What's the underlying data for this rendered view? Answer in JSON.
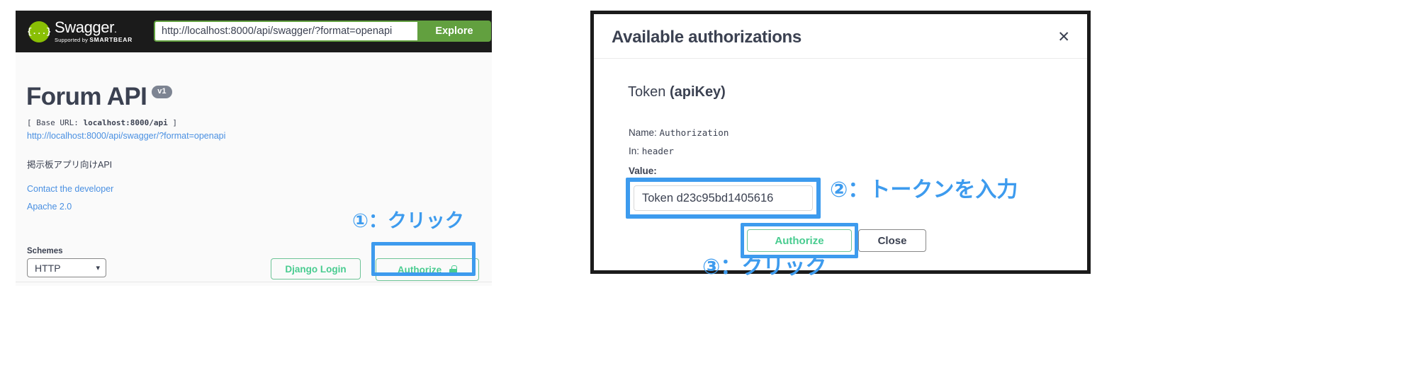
{
  "swagger": {
    "topbar": {
      "logo_name": "Swagger",
      "logo_braces": "{...}",
      "logo_supported_prefix": "Supported by ",
      "logo_supported_brand": "SMARTBEAR",
      "url_value": "http://localhost:8000/api/swagger/?format=openapi",
      "explore_label": "Explore"
    },
    "info": {
      "title": "Forum API",
      "version": "v1",
      "base_url_prefix": "[ Base URL: ",
      "base_url": "localhost:8000/api",
      "base_url_suffix": " ]",
      "spec_link": "http://localhost:8000/api/swagger/?format=openapi",
      "description": "掲示板アプリ向けAPI",
      "contact_link": "Contact the developer",
      "license_link": "Apache 2.0"
    },
    "schemes": {
      "label": "Schemes",
      "selected": "HTTP",
      "options": [
        "HTTP"
      ],
      "caret": "chevron-down"
    },
    "actions": {
      "django_login": "Django Login",
      "authorize": "Authorize",
      "lock_icon": "lock-icon"
    }
  },
  "modal": {
    "title": "Available authorizations",
    "close_icon": "✕",
    "scheme_name": "Token ",
    "scheme_type": "(apiKey)",
    "name_label": "Name: ",
    "name_value": "Authorization",
    "in_label": "In: ",
    "in_value": "header",
    "value_label": "Value:",
    "token_value": "Token d23c95bd1405616",
    "authorize_label": "Authorize",
    "close_label": "Close"
  },
  "annotations": {
    "step1": "①：クリック",
    "step2": "②：トークンを入力",
    "step3": "③：クリック",
    "highlight_color": "#3d9bee"
  }
}
